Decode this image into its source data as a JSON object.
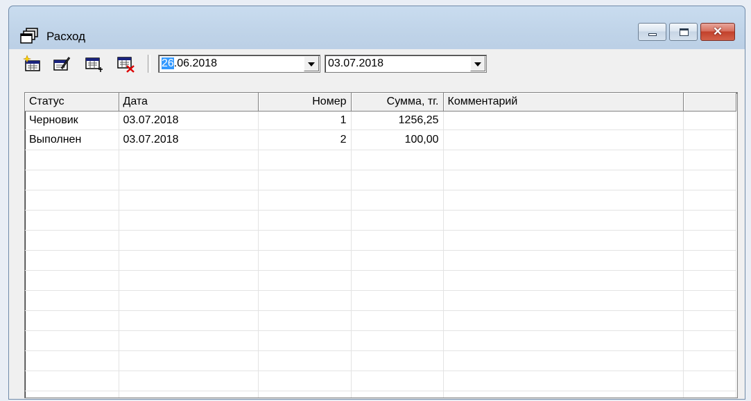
{
  "window": {
    "title": "Расход",
    "title_icon": "stacked-windows-icon"
  },
  "toolbar": {
    "buttons": [
      {
        "icon": "new-document-sparkle-icon"
      },
      {
        "icon": "edit-document-icon"
      },
      {
        "icon": "add-row-icon"
      },
      {
        "icon": "delete-row-icon"
      }
    ],
    "date_from": {
      "selected_part": "26",
      "rest": ".06.2018"
    },
    "date_to": "03.07.2018"
  },
  "table": {
    "columns": [
      "Статус",
      "Дата",
      "Номер",
      "Сумма, тг.",
      "Комментарий",
      ""
    ],
    "rows": [
      [
        "Черновик",
        "03.07.2018",
        "1",
        "1256,25",
        "",
        ""
      ],
      [
        "Выполнен",
        "03.07.2018",
        "2",
        "100,00",
        "",
        ""
      ]
    ]
  },
  "colors": {
    "selection": "#3399ff",
    "close_button": "#c2412b"
  }
}
